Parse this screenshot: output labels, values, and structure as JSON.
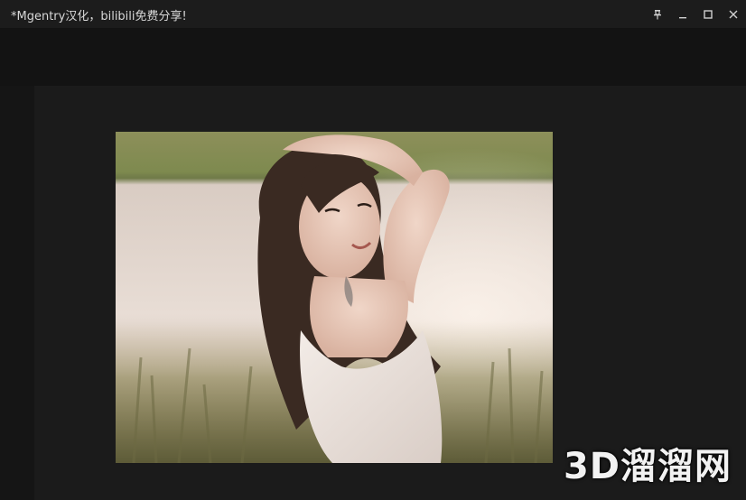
{
  "window": {
    "title": "*Mgentry汉化，bilibili免费分享!",
    "controls": {
      "pin_icon": "pin-icon",
      "minimize_icon": "minimize-icon",
      "maximize_icon": "maximize-icon",
      "close_icon": "close-icon"
    }
  },
  "viewer": {
    "image": "portrait-photo",
    "watermark": "3D溜溜网"
  },
  "colors": {
    "titlebar_bg": "#1c1c1c",
    "workspace_bg": "#131313",
    "viewport_bg": "#1b1b1b",
    "title_text": "#d8d8d8"
  }
}
